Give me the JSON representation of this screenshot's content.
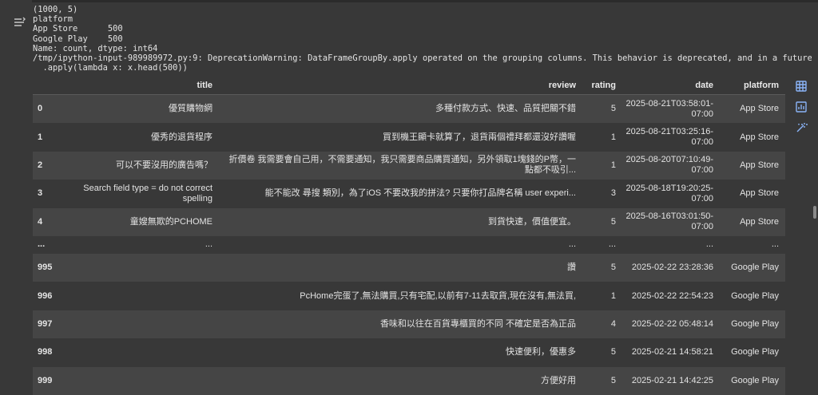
{
  "output": {
    "lines": [
      "(1000, 5)",
      "platform",
      "App Store      500",
      "Google Play    500",
      "Name: count, dtype: int64",
      "/tmp/ipython-input-989989972.py:9: DeprecationWarning: DataFrameGroupBy.apply operated on the grouping columns. This behavior is deprecated, and in a future ver",
      "  .apply(lambda x: x.head(500))"
    ]
  },
  "table": {
    "columns": [
      "",
      "title",
      "review",
      "rating",
      "date",
      "platform"
    ],
    "rows": [
      {
        "idx": "0",
        "title": "優質購物網",
        "review": "多種付款方式、快速、品質把關不錯",
        "rating": "5",
        "date": "2025-08-21T03:58:01-07:00",
        "platform": "App Store"
      },
      {
        "idx": "1",
        "title": "優秀的退貨程序",
        "review": "買到機王顯卡就算了，退貨兩個禮拜都還沒好讚喔",
        "rating": "1",
        "date": "2025-08-21T03:25:16-07:00",
        "platform": "App Store"
      },
      {
        "idx": "2",
        "title": "可以不要沒用的廣告嗎？",
        "review": "折價卷 我需要會自己用，不需要通知，我只需要商品購買通知，另外領取1塊錢的P幣，一點都不吸引...",
        "rating": "1",
        "date": "2025-08-20T07:10:49-07:00",
        "platform": "App Store"
      },
      {
        "idx": "3",
        "title": "Search field type = do not correct spelling",
        "review": "能不能改 尋搜 類別，為了iOS 不要改我的拼法? 只要你打品牌名稱 user experi...",
        "rating": "3",
        "date": "2025-08-18T19:20:25-07:00",
        "platform": "App Store"
      },
      {
        "idx": "4",
        "title": "童嫂無欺的PCHOME",
        "review": "到貨快速，價值便宜。",
        "rating": "5",
        "date": "2025-08-16T03:01:50-07:00",
        "platform": "App Store"
      },
      {
        "idx": "...",
        "title": "...",
        "review": "...",
        "rating": "...",
        "date": "...",
        "platform": "...",
        "ellipsis": true
      },
      {
        "idx": "995",
        "title": "",
        "review": "讚",
        "rating": "5",
        "date": "2025-02-22 23:28:36",
        "platform": "Google Play"
      },
      {
        "idx": "996",
        "title": "",
        "review": "PcHome完蛋了,無法購買,只有宅配,以前有7-11去取貨,現在沒有,無法買,",
        "rating": "1",
        "date": "2025-02-22 22:54:23",
        "platform": "Google Play"
      },
      {
        "idx": "997",
        "title": "",
        "review": "香味和以往在百貨專櫃買的不同 不確定是否為正品",
        "rating": "4",
        "date": "2025-02-22 05:48:14",
        "platform": "Google Play"
      },
      {
        "idx": "998",
        "title": "",
        "review": "快速便利，優惠多",
        "rating": "5",
        "date": "2025-02-21 14:58:21",
        "platform": "Google Play"
      },
      {
        "idx": "999",
        "title": "",
        "review": "方便好用",
        "rating": "5",
        "date": "2025-02-21 14:42:25",
        "platform": "Google Play"
      }
    ]
  },
  "icons": {
    "output_toggle": "output-settings-icon",
    "table_view": "table-icon",
    "chart": "chart-icon",
    "magic": "magic-wand-icon"
  }
}
